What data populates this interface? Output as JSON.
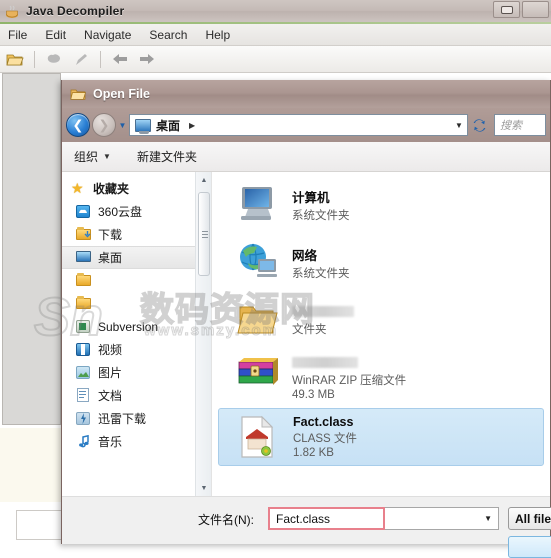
{
  "app": {
    "title": "Java Decompiler",
    "icon": "java-coffee-icon",
    "window_controls": [
      "minimize",
      "maximize"
    ],
    "menu": [
      "File",
      "Edit",
      "Navigate",
      "Search",
      "Help"
    ],
    "toolbar": [
      {
        "name": "open-folder-icon",
        "enabled": true
      },
      {
        "name": "save-icon",
        "enabled": false
      },
      {
        "name": "edit-pencil-icon",
        "enabled": false
      },
      {
        "name": "back-arrow-icon",
        "enabled": true
      },
      {
        "name": "forward-arrow-icon",
        "enabled": true
      }
    ]
  },
  "dialog": {
    "title": "Open File",
    "title_icon": "folder-open-icon",
    "nav": {
      "back_icon": "back-circle-icon",
      "forward_icon": "forward-circle-icon",
      "history_icon": "history-dropdown-icon",
      "address_icon": "desktop-monitor-icon",
      "address_text": "桌面",
      "address_separator": "▶",
      "address_dropdown": "▼",
      "refresh_icon": "refresh-icon",
      "search_placeholder": "搜索"
    },
    "commands": {
      "organize": "组织",
      "organize_caret": "▼",
      "new_folder": "新建文件夹"
    },
    "sidebar": [
      {
        "label": "收藏夹",
        "icon": "star-icon",
        "group": true,
        "selected": false
      },
      {
        "label": "360云盘",
        "icon": "cloud-disk-icon",
        "group": false,
        "selected": false
      },
      {
        "label": "下载",
        "icon": "download-folder-icon",
        "group": false,
        "selected": false
      },
      {
        "label": "桌面",
        "icon": "desktop-monitor-icon",
        "group": false,
        "selected": true
      },
      {
        "label": "",
        "icon": "folder-icon",
        "group": false,
        "selected": false
      },
      {
        "label": "",
        "icon": "folder-icon",
        "group": false,
        "selected": false
      },
      {
        "label": "Subversion",
        "icon": "subversion-icon",
        "group": false,
        "selected": false
      },
      {
        "label": "视频",
        "icon": "video-folder-icon",
        "group": false,
        "selected": false
      },
      {
        "label": "图片",
        "icon": "pictures-folder-icon",
        "group": false,
        "selected": false
      },
      {
        "label": "文档",
        "icon": "documents-folder-icon",
        "group": false,
        "selected": false
      },
      {
        "label": "迅雷下载",
        "icon": "thunder-download-icon",
        "group": false,
        "selected": false
      },
      {
        "label": "音乐",
        "icon": "music-note-icon",
        "group": false,
        "selected": false
      }
    ],
    "files": [
      {
        "name": "计算机",
        "type": "系统文件夹",
        "size": "",
        "icon": "computer-icon",
        "selected": false,
        "redacted_name": false
      },
      {
        "name": "网络",
        "type": "系统文件夹",
        "size": "",
        "icon": "network-globe-icon",
        "selected": false,
        "redacted_name": false
      },
      {
        "name": "",
        "type": "文件夹",
        "size": "",
        "icon": "folder-icon",
        "selected": false,
        "redacted_name": true
      },
      {
        "name": "",
        "type": "WinRAR ZIP 压缩文件",
        "size": "49.3 MB",
        "icon": "winrar-archive-icon",
        "selected": false,
        "redacted_name": true
      },
      {
        "name": "Fact.class",
        "type": "CLASS 文件",
        "size": "1.82 KB",
        "icon": "class-file-icon",
        "selected": true,
        "redacted_name": false
      }
    ],
    "footer": {
      "filename_label": "文件名(N):",
      "filename_value": "Fact.class",
      "filename_dropdown": "▼",
      "filter_label": "All file",
      "open_label": ""
    },
    "scrollbar": {
      "up": "▲",
      "down": "▼"
    }
  },
  "watermark": {
    "logo": "Sn",
    "text": "数码资源网",
    "url": "www.smzy.com"
  },
  "colors": {
    "title_accent": "#a1968f",
    "selection_blue": "#c7e1f5",
    "highlight_red": "#e8808c",
    "nav_blue": "#2a7fd4"
  }
}
